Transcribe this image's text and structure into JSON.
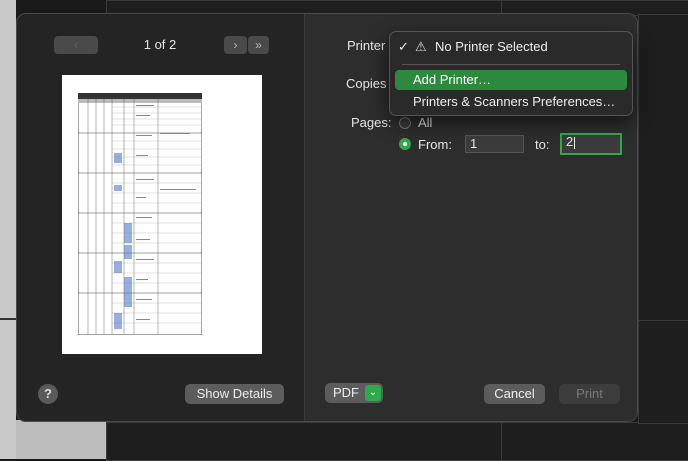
{
  "nav": {
    "prev_label": "‹",
    "next_label": "›",
    "last_label": "»",
    "page_indicator": "1 of 2"
  },
  "labels": {
    "printer": "Printer",
    "copies": "Copies",
    "pages": "Pages:",
    "all": "All",
    "from": "From:",
    "to": "to:"
  },
  "pages": {
    "from_value": "1",
    "to_value": "2",
    "selected_option": "From"
  },
  "printer_menu": {
    "items": [
      {
        "label": "No Printer Selected",
        "checked": true,
        "icon": "warning-icon"
      },
      {
        "label": "Add Printer…"
      },
      {
        "label": "Printers & Scanners Preferences…"
      }
    ],
    "checkmark": "✓",
    "warning_glyph": "⚠"
  },
  "buttons": {
    "help": "?",
    "show_details": "Show Details",
    "pdf": "PDF",
    "pdf_chevron": "⌄",
    "cancel": "Cancel",
    "print": "Print"
  },
  "colors": {
    "accent": "#2eaa47",
    "menu_highlight": "#2b8a3e"
  }
}
